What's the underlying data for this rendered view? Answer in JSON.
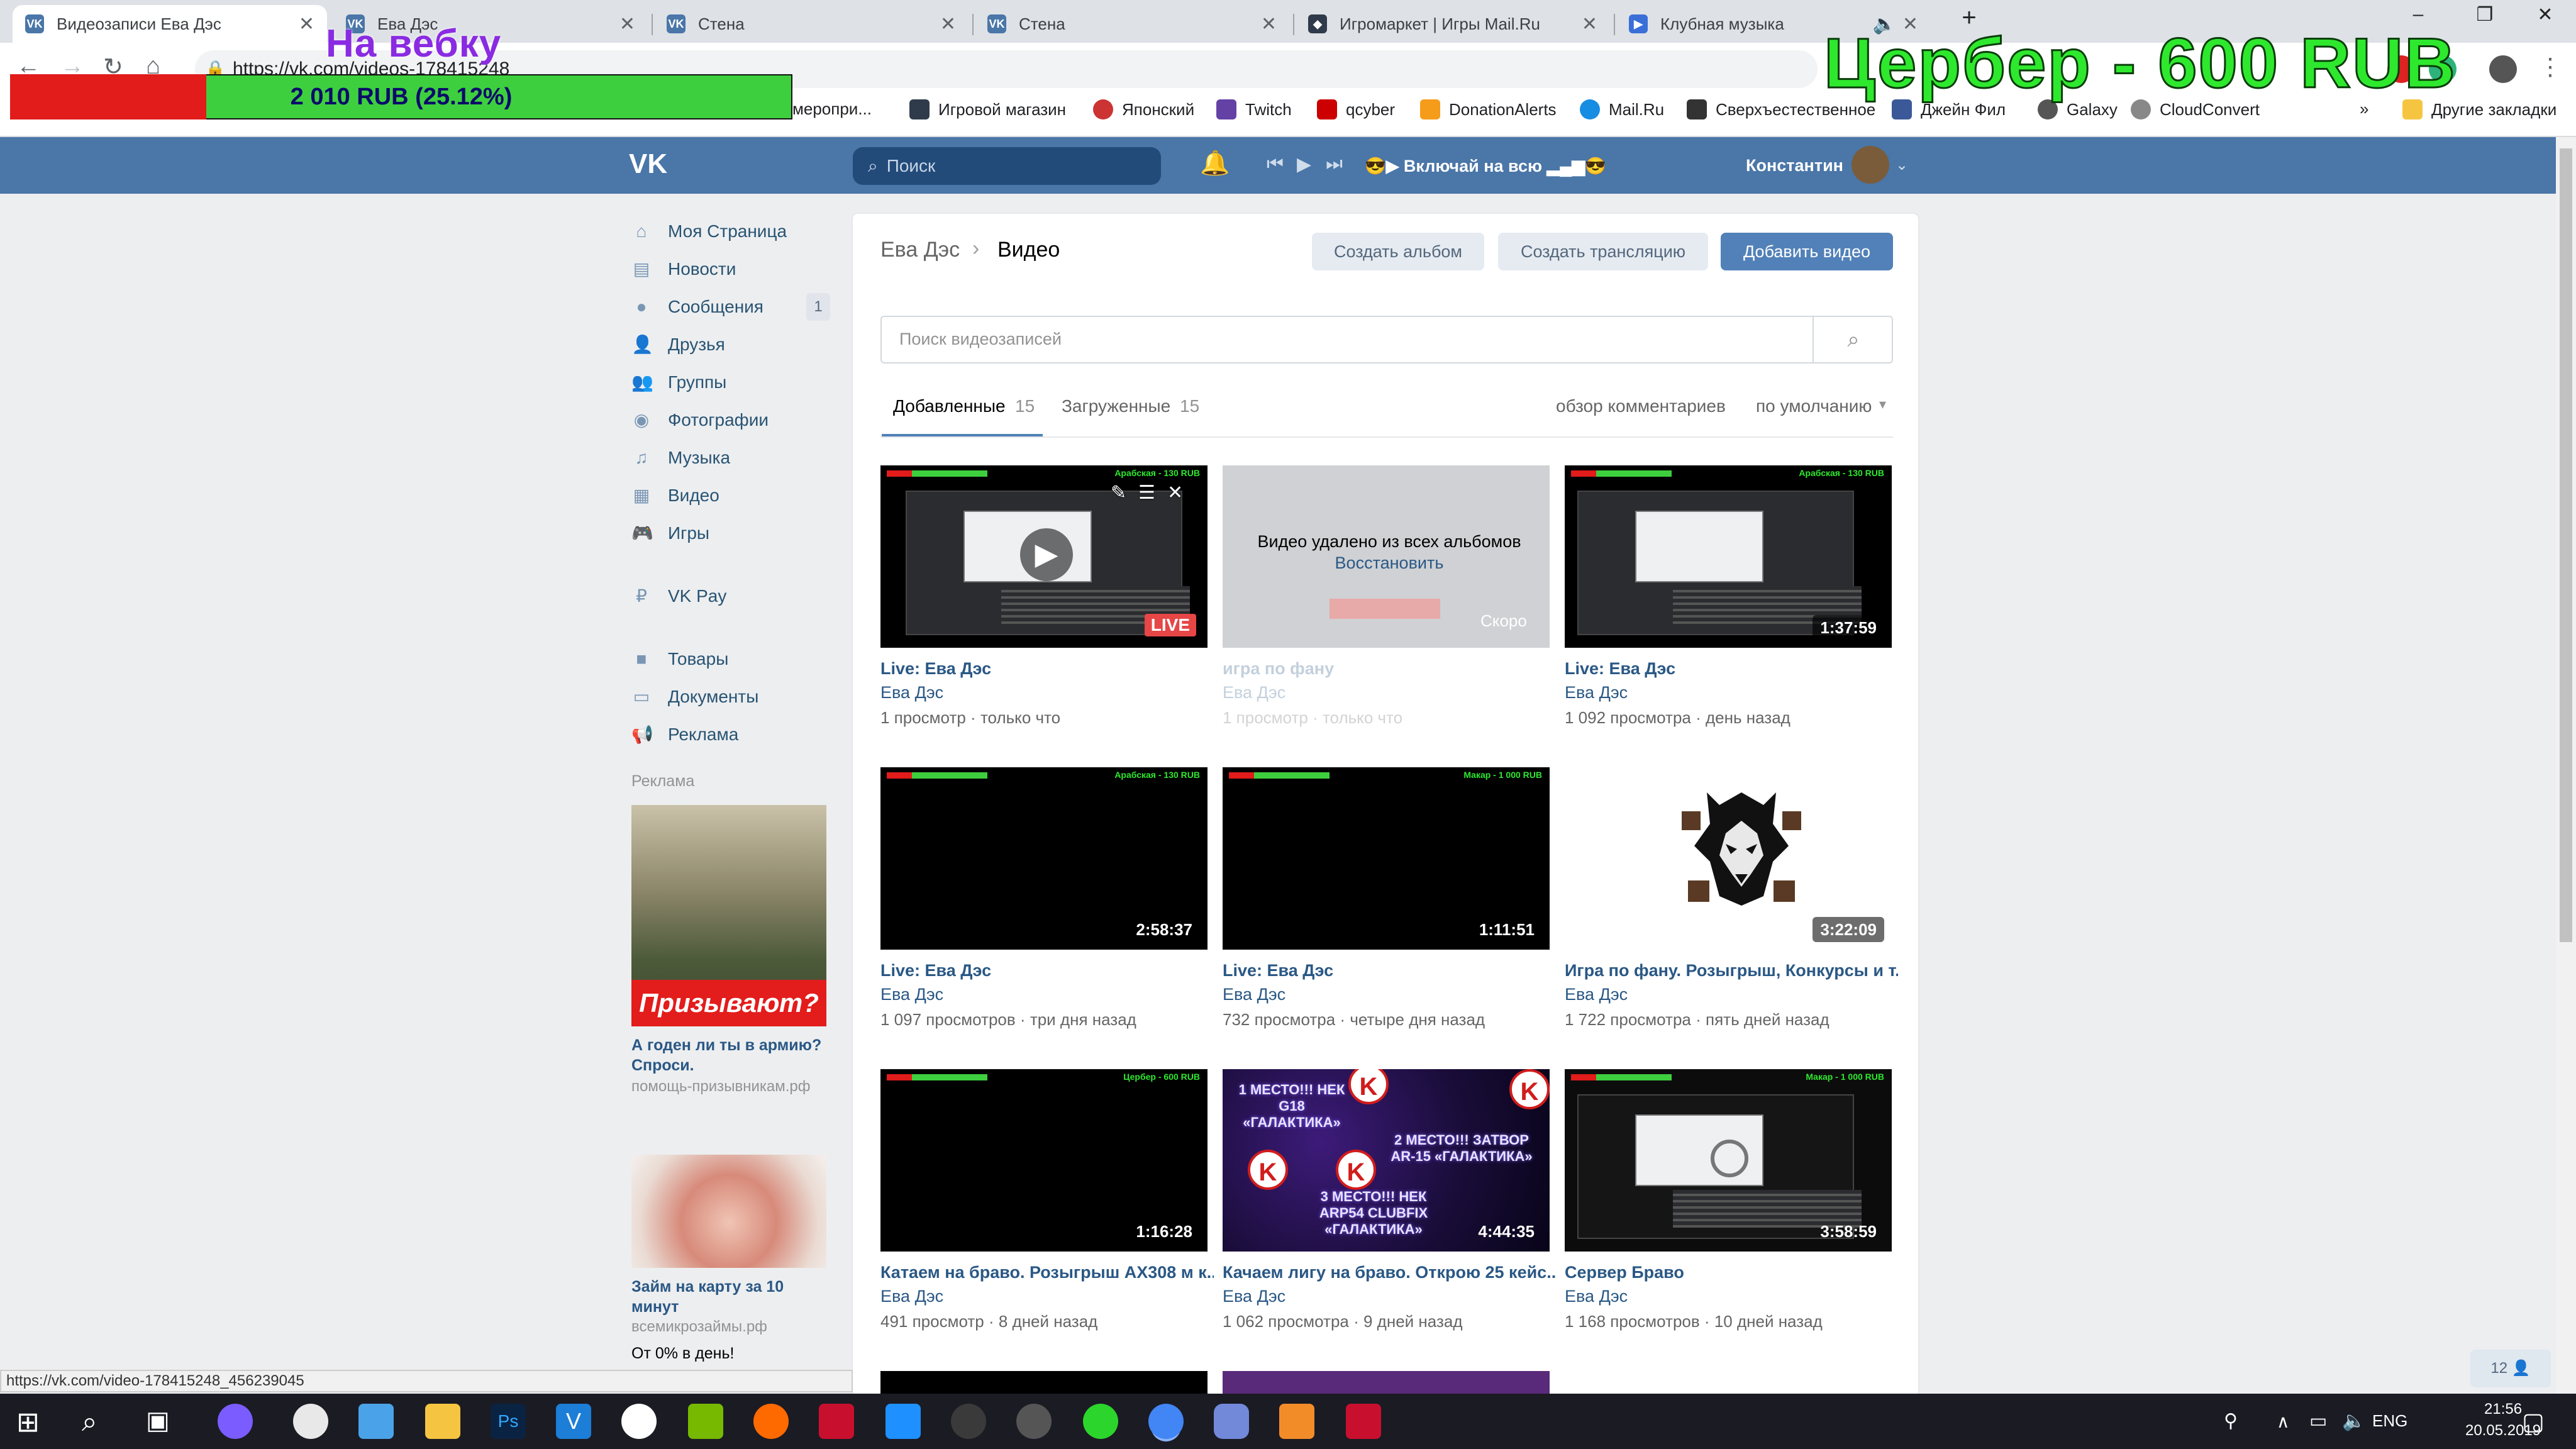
{
  "browser": {
    "tabs": [
      {
        "title": "Видеозаписи Ева Дэс",
        "active": true
      },
      {
        "title": "Ева Дэс"
      },
      {
        "title": "Стена"
      },
      {
        "title": "Стена"
      },
      {
        "title": "Игромаркет | Игры Mail.Ru"
      },
      {
        "title": "Клубная музыка"
      }
    ],
    "new_tab": "+",
    "window_controls": {
      "minimize": "–",
      "restore": "❐",
      "close": "✕"
    },
    "url": "https://vk.com/videos-178415248",
    "bookmarks": [
      {
        "label": "меропри..."
      },
      {
        "label": "Игровой магазин",
        "color": "#2f3b4a"
      },
      {
        "label": "Японский",
        "color": "#c33"
      },
      {
        "label": "Twitch",
        "color": "#6441a5"
      },
      {
        "label": "qcyber",
        "color": "#c00"
      },
      {
        "label": "DonationAlerts",
        "color": "#f59c1a"
      },
      {
        "label": "Mail.Ru",
        "color": "#168de2"
      },
      {
        "label": "Сверхъестественное",
        "color": "#333"
      },
      {
        "label": "Джейн Фил",
        "color": "#3b5998"
      },
      {
        "label": "Galaxy",
        "color": "#555"
      },
      {
        "label": "CloudConvert",
        "color": "#888"
      }
    ],
    "bookmarks_more": "»",
    "other_bookmarks": "Другие закладки",
    "status_url": "https://vk.com/video-178415248_456239045"
  },
  "overlay": {
    "webcam_label": "На вебку",
    "progress_text": "2 010 RUB (25.12%)",
    "progress_fraction": 0.2512,
    "goal_text": "Цербер - 600 RUB"
  },
  "vk": {
    "logo": "VK",
    "search_placeholder": "Поиск",
    "player_text": "😎▶ Включай на всю ▂▄▆😎",
    "user_name": "Константин",
    "nav": [
      {
        "label": "Моя Страница",
        "icon": "home-icon"
      },
      {
        "label": "Новости",
        "icon": "news-icon"
      },
      {
        "label": "Сообщения",
        "icon": "messages-icon",
        "badge": "1"
      },
      {
        "label": "Друзья",
        "icon": "friends-icon"
      },
      {
        "label": "Группы",
        "icon": "groups-icon"
      },
      {
        "label": "Фотографии",
        "icon": "camera-icon"
      },
      {
        "label": "Музыка",
        "icon": "music-icon"
      },
      {
        "label": "Видео",
        "icon": "video-icon"
      },
      {
        "label": "Игры",
        "icon": "gamepad-icon"
      },
      {
        "label": "VK Pay",
        "icon": "vkpay-icon"
      },
      {
        "label": "Товары",
        "icon": "bag-icon"
      },
      {
        "label": "Документы",
        "icon": "document-icon"
      },
      {
        "label": "Реклама",
        "icon": "megaphone-icon"
      }
    ],
    "ads_heading": "Реклама",
    "ads": [
      {
        "banner": "Призывают?",
        "title": "А годен ли ты в армию? Спроси.",
        "source": "помощь-призывникам.рф"
      },
      {
        "title": "Займ на карту за 10 минут",
        "source": "всемикрозаймы.рф",
        "extra": "От 0% в день!"
      }
    ],
    "online_counter": "12 👤"
  },
  "page": {
    "breadcrumb_owner": "Ева Дэс",
    "breadcrumb_sep": "›",
    "breadcrumb_current": "Видео",
    "btn_create_album": "Создать альбом",
    "btn_create_stream": "Создать трансляцию",
    "btn_add_video": "Добавить видео",
    "search_placeholder": "Поиск видеозаписей",
    "tabs": [
      {
        "label": "Добавленные",
        "count": "15",
        "active": true
      },
      {
        "label": "Загруженные",
        "count": "15"
      }
    ],
    "sort_comments": "обзор комментариев",
    "sort_default": "по умолчанию",
    "deleted_msg": "Видео удалено из всех альбомов",
    "restore_link": "Восстановить",
    "soon_label": "Скоро",
    "live_badge": "LIVE",
    "videos": [
      {
        "title": "Live: Ева Дэс",
        "author": "Ева Дэс",
        "views": "1 просмотр",
        "time": "только что",
        "live": true
      },
      {
        "title": "игра по фану",
        "author": "Ева Дэс",
        "views": "1 просмотр",
        "time": "только что",
        "deleted": true
      },
      {
        "title": "Live: Ева Дэс",
        "author": "Ева Дэс",
        "views": "1 092 просмотра",
        "time": "день назад",
        "duration": "1:37:59"
      },
      {
        "title": "Live: Ева Дэс",
        "author": "Ева Дэс",
        "views": "1 097 просмотров",
        "time": "три дня назад",
        "duration": "2:58:37"
      },
      {
        "title": "Live: Ева Дэс",
        "author": "Ева Дэс",
        "views": "732 просмотра",
        "time": "четыре дня назад",
        "duration": "1:11:51"
      },
      {
        "title": "Игра по фану. Розыгрыш, Конкурсы и т...",
        "author": "Ева Дэс",
        "views": "1 722 просмотра",
        "time": "пять дней назад",
        "duration": "3:22:09"
      },
      {
        "title": "Катаем на браво. Розыгрыш АХ308 м к...",
        "author": "Ева Дэс",
        "views": "491 просмотр",
        "time": "8 дней назад",
        "duration": "1:16:28"
      },
      {
        "title": "Качаем лигу на браво. Открою 25 кейс...",
        "author": "Ева Дэс",
        "views": "1 062 просмотра",
        "time": "9 дней назад",
        "duration": "4:44:35"
      },
      {
        "title": "Сервер Браво",
        "author": "Ева Дэс",
        "views": "1 168 просмотров",
        "time": "10 дней назад",
        "duration": "3:58:59"
      }
    ]
  },
  "thumb_text": {
    "ov_a": "Арабская - 130 RUB",
    "ov_b": "Макар - 1 000 RUB",
    "ov_c": "Цербер - 600 RUB",
    "galaxy_1": "1 МЕСТО!!! НЕК G18 «ГАЛАКТИКА»",
    "galaxy_2": "2 МЕСТО!!! ЗАТВОР AR-15 «ГАЛАКТИКА»",
    "galaxy_3": "3 МЕСТО!!! НЕК ARP54 CLUBFIX «ГАЛАКТИКА»"
  },
  "taskbar": {
    "lang": "ENG",
    "time": "21:56",
    "date": "20.05.2019"
  }
}
